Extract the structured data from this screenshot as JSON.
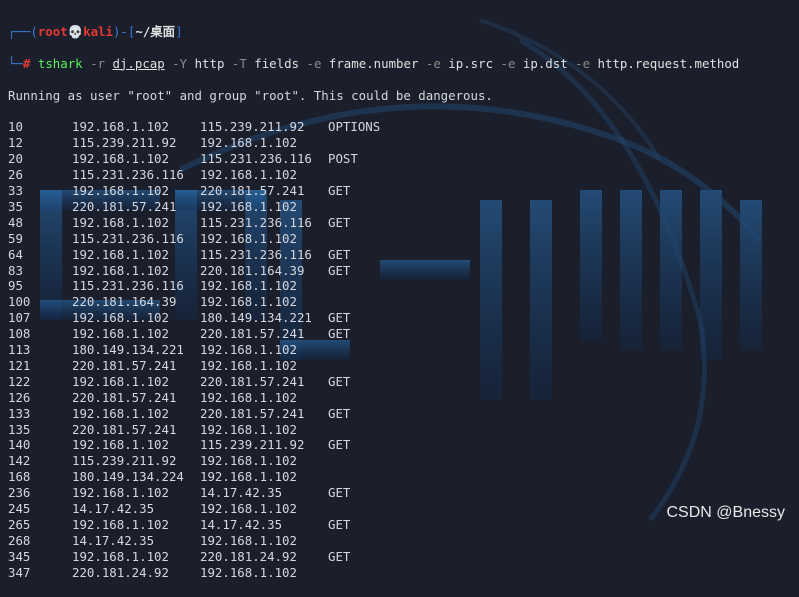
{
  "prompt": {
    "user": "root",
    "skull": "💀",
    "host": "kali",
    "path": "~/桌面",
    "hash": "#"
  },
  "command": {
    "program": "tshark",
    "flag_r": "-r",
    "file": "dj.pcap",
    "flag_Y": "-Y",
    "filter": "http",
    "flag_T": "-T",
    "format": "fields",
    "e1": "-e",
    "f1": "frame.number",
    "e2": "-e",
    "f2": "ip.src",
    "e3": "-e",
    "f3": "ip.dst",
    "e4": "-e",
    "f4": "http.request.method"
  },
  "warning": "Running as user \"root\" and group \"root\". This could be dangerous.",
  "rows": [
    [
      "10",
      "192.168.1.102",
      "115.239.211.92",
      "OPTIONS"
    ],
    [
      "12",
      "115.239.211.92",
      "192.168.1.102",
      ""
    ],
    [
      "20",
      "192.168.1.102",
      "115.231.236.116",
      "POST"
    ],
    [
      "26",
      "115.231.236.116",
      "192.168.1.102",
      ""
    ],
    [
      "33",
      "192.168.1.102",
      "220.181.57.241",
      "GET"
    ],
    [
      "35",
      "220.181.57.241",
      "192.168.1.102",
      ""
    ],
    [
      "48",
      "192.168.1.102",
      "115.231.236.116",
      "GET"
    ],
    [
      "59",
      "115.231.236.116",
      "192.168.1.102",
      ""
    ],
    [
      "64",
      "192.168.1.102",
      "115.231.236.116",
      "GET"
    ],
    [
      "83",
      "192.168.1.102",
      "220.181.164.39",
      "GET"
    ],
    [
      "95",
      "115.231.236.116",
      "192.168.1.102",
      ""
    ],
    [
      "100",
      "220.181.164.39",
      "192.168.1.102",
      ""
    ],
    [
      "107",
      "192.168.1.102",
      "180.149.134.221",
      "GET"
    ],
    [
      "108",
      "192.168.1.102",
      "220.181.57.241",
      "GET"
    ],
    [
      "113",
      "180.149.134.221",
      "192.168.1.102",
      ""
    ],
    [
      "121",
      "220.181.57.241",
      "192.168.1.102",
      ""
    ],
    [
      "122",
      "192.168.1.102",
      "220.181.57.241",
      "GET"
    ],
    [
      "126",
      "220.181.57.241",
      "192.168.1.102",
      ""
    ],
    [
      "133",
      "192.168.1.102",
      "220.181.57.241",
      "GET"
    ],
    [
      "135",
      "220.181.57.241",
      "192.168.1.102",
      ""
    ],
    [
      "140",
      "192.168.1.102",
      "115.239.211.92",
      "GET"
    ],
    [
      "142",
      "115.239.211.92",
      "192.168.1.102",
      ""
    ],
    [
      "168",
      "180.149.134.224",
      "192.168.1.102",
      ""
    ],
    [
      "236",
      "192.168.1.102",
      "14.17.42.35",
      "GET"
    ],
    [
      "245",
      "14.17.42.35",
      "192.168.1.102",
      ""
    ],
    [
      "265",
      "192.168.1.102",
      "14.17.42.35",
      "GET"
    ],
    [
      "268",
      "14.17.42.35",
      "192.168.1.102",
      ""
    ],
    [
      "345",
      "192.168.1.102",
      "220.181.24.92",
      "GET"
    ],
    [
      "347",
      "220.181.24.92",
      "192.168.1.102",
      ""
    ]
  ],
  "watermark": "CSDN @Bnessy",
  "colors": {
    "background": "#1b1e2b",
    "prompt_frame": "#3b7bd6",
    "root": "#e53935",
    "command": "#5af25a",
    "flag": "#8a8a8a"
  }
}
